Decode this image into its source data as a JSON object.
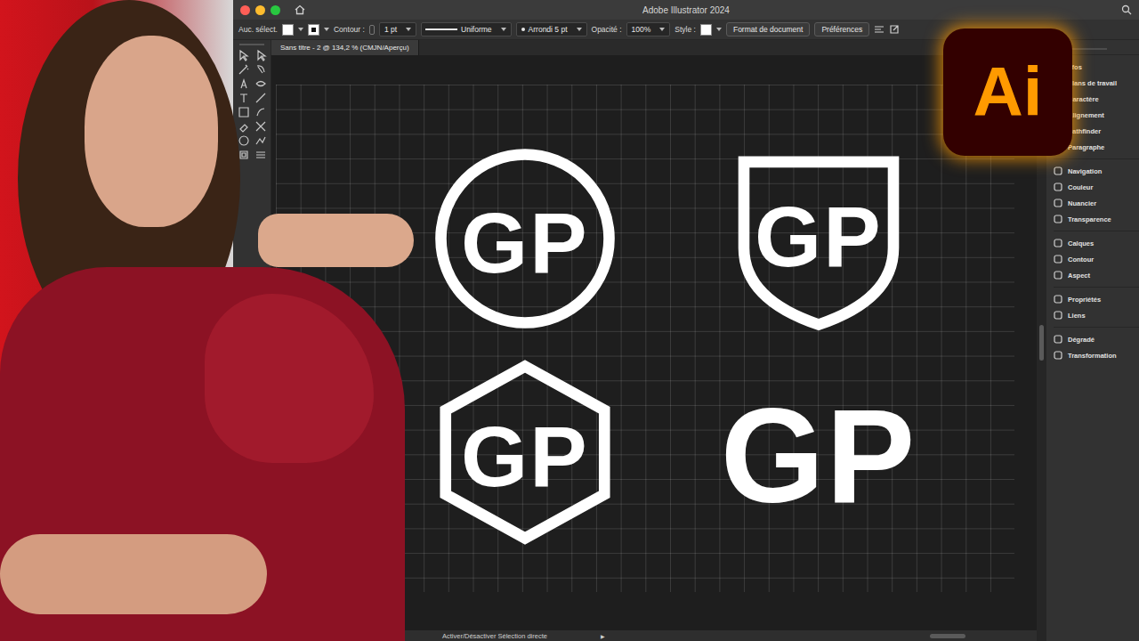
{
  "window": {
    "title": "Adobe Illustrator 2024"
  },
  "control_bar": {
    "selection": "Auc. sélect.",
    "stroke_label": "Contour :",
    "stroke_weight": "1 pt",
    "profile": "Uniforme",
    "brush": "Arrondi 5 pt",
    "opacity_label": "Opacité :",
    "opacity": "100%",
    "style_label": "Style :",
    "buttons": [
      "Format de document",
      "Préférences"
    ]
  },
  "document_tab": {
    "label": "Sans titre - 2 @ 134,2 % (CMJN/Aperçu)",
    "selected": true
  },
  "artboard": {
    "logos": [
      {
        "text": "GP",
        "kind": "circle"
      },
      {
        "text": "GP",
        "kind": "shield"
      },
      {
        "text": "GP",
        "kind": "hexagon"
      },
      {
        "text": "GP",
        "kind": "square"
      }
    ]
  },
  "panels": [
    [
      "nfos",
      "Plans de travail",
      "Caractère",
      "Alignement",
      "Pathfinder",
      "Paragraphe"
    ],
    [
      "Navigation",
      "Couleur",
      "Nuancier",
      "Transparence"
    ],
    [
      "Calques",
      "Contour",
      "Aspect"
    ],
    [
      "Propriétés",
      "Liens"
    ],
    [
      "Dégradé",
      "Transformation"
    ]
  ],
  "app_logo": {
    "text": "Ai"
  },
  "status_bar": {
    "message": "Activer/Désactiver Sélection directe",
    "arrow": "▶"
  }
}
